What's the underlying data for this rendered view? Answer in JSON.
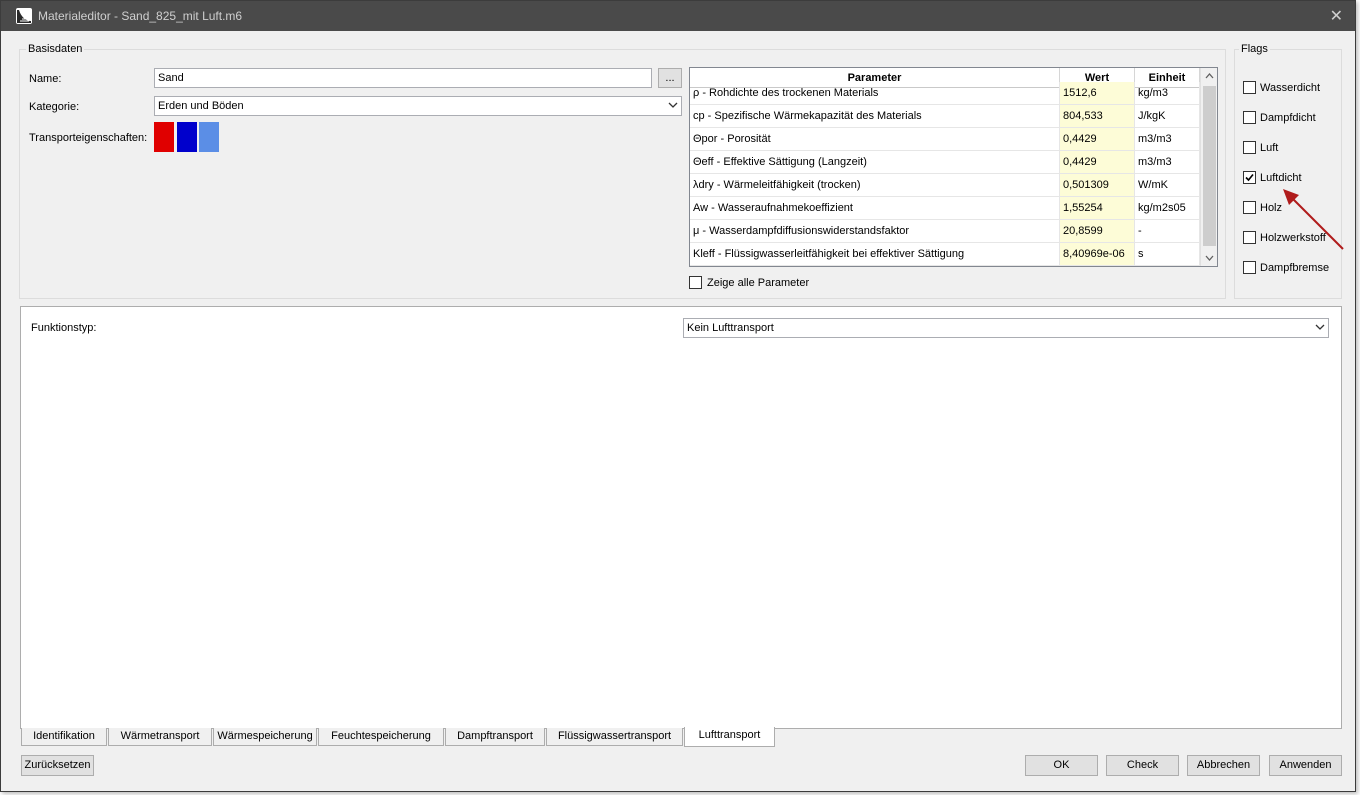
{
  "window": {
    "title": "Materialeditor - Sand_825_mit Luft.m6",
    "close_glyph": "✕"
  },
  "basisdaten": {
    "group_label": "Basisdaten",
    "name_label": "Name:",
    "name_value": "Sand",
    "browse_label": "...",
    "kategorie_label": "Kategorie:",
    "kategorie_value": "Erden und Böden",
    "transport_label": "Transporteigenschaften:",
    "swatches": [
      "#e00000",
      "#0000cc",
      "#5b8ee6"
    ]
  },
  "param_table": {
    "headers": {
      "parameter": "Parameter",
      "wert": "Wert",
      "einheit": "Einheit"
    },
    "rows": [
      {
        "parameter": "ρ - Rohdichte des trockenen Materials",
        "wert": "1512,6",
        "einheit": "kg/m3"
      },
      {
        "parameter": "cp - Spezifische Wärmekapazität des Materials",
        "wert": "804,533",
        "einheit": "J/kgK"
      },
      {
        "parameter": "Θpor - Porosität",
        "wert": "0,4429",
        "einheit": "m3/m3"
      },
      {
        "parameter": "Θeff - Effektive Sättigung (Langzeit)",
        "wert": "0,4429",
        "einheit": "m3/m3"
      },
      {
        "parameter": "λdry - Wärmeleitfähigkeit (trocken)",
        "wert": "0,501309",
        "einheit": "W/mK"
      },
      {
        "parameter": "Aw - Wasseraufnahmekoeffizient",
        "wert": "1,55254",
        "einheit": "kg/m2s05"
      },
      {
        "parameter": "μ - Wasserdampfdiffusionswiderstandsfaktor",
        "wert": "20,8599",
        "einheit": "-"
      },
      {
        "parameter": "Kleff - Flüssigwasserleitfähigkeit bei effektiver Sättigung",
        "wert": "8,40969e-06",
        "einheit": "s"
      }
    ],
    "show_all_label": "Zeige alle Parameter",
    "show_all_checked": false
  },
  "flags": {
    "group_label": "Flags",
    "items": [
      {
        "label": "Wasserdicht",
        "checked": false
      },
      {
        "label": "Dampfdicht",
        "checked": false
      },
      {
        "label": "Luft",
        "checked": false
      },
      {
        "label": "Luftdicht",
        "checked": true
      },
      {
        "label": "Holz",
        "checked": false
      },
      {
        "label": "Holzwerkstoff",
        "checked": false
      },
      {
        "label": "Dampfbremse",
        "checked": false
      }
    ]
  },
  "funktion": {
    "label": "Funktionstyp:",
    "value": "Kein Lufttransport"
  },
  "tabs": [
    {
      "label": "Identifikation",
      "active": false
    },
    {
      "label": "Wärmetransport",
      "active": false
    },
    {
      "label": "Wärmespeicherung",
      "active": false
    },
    {
      "label": "Feuchtespeicherung",
      "active": false
    },
    {
      "label": "Dampftransport",
      "active": false
    },
    {
      "label": "Flüssigwassertransport",
      "active": false
    },
    {
      "label": "Lufttransport",
      "active": true
    }
  ],
  "footer": {
    "reset_label": "Zurücksetzen",
    "ok_label": "OK",
    "check_label": "Check",
    "cancel_label": "Abbrechen",
    "apply_label": "Anwenden"
  },
  "colors": {
    "annotation_arrow": "#b01c1c",
    "value_cell_bg": "#fdfcd7",
    "titlebar_bg": "#4a4a4a"
  }
}
